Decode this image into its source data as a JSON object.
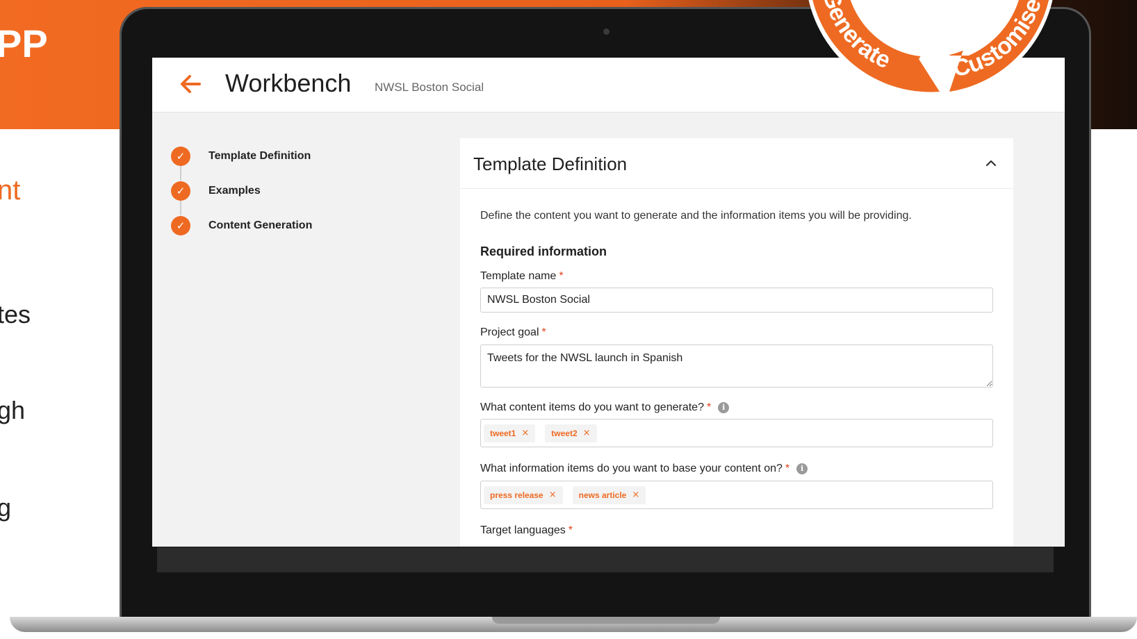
{
  "slide": {
    "title_fragment": "PP",
    "accent_fragment": "nt",
    "lines": [
      "tes",
      "gh",
      "g"
    ]
  },
  "badge": {
    "word_left": "Generate",
    "word_right": "Customise"
  },
  "app": {
    "title": "Workbench",
    "subtitle": "NWSL Boston Social",
    "back_icon": "arrow-left-icon"
  },
  "stepper": {
    "steps": [
      {
        "label": "Template Definition",
        "status": "complete"
      },
      {
        "label": "Examples",
        "status": "complete"
      },
      {
        "label": "Content Generation",
        "status": "complete"
      }
    ]
  },
  "card": {
    "title": "Template Definition",
    "description": "Define the content you want to generate and the information items you will be providing.",
    "section_heading": "Required information",
    "fields": {
      "template_name": {
        "label": "Template name",
        "required": "*",
        "value": "NWSL Boston Social"
      },
      "project_goal": {
        "label": "Project goal",
        "required": "*",
        "value": "Tweets for the NWSL launch in Spanish"
      },
      "content_items": {
        "label": "What content items do you want to generate?",
        "required": "*",
        "tags": [
          "tweet1",
          "tweet2"
        ]
      },
      "information_items": {
        "label": "What information items do you want to base your content on?",
        "required": "*",
        "tags": [
          "press release",
          "news article"
        ]
      },
      "target_languages": {
        "label": "Target languages",
        "required": "*"
      }
    }
  },
  "colors": {
    "accent": "#ee6a22",
    "required": "#e0441a",
    "text": "#222222"
  }
}
